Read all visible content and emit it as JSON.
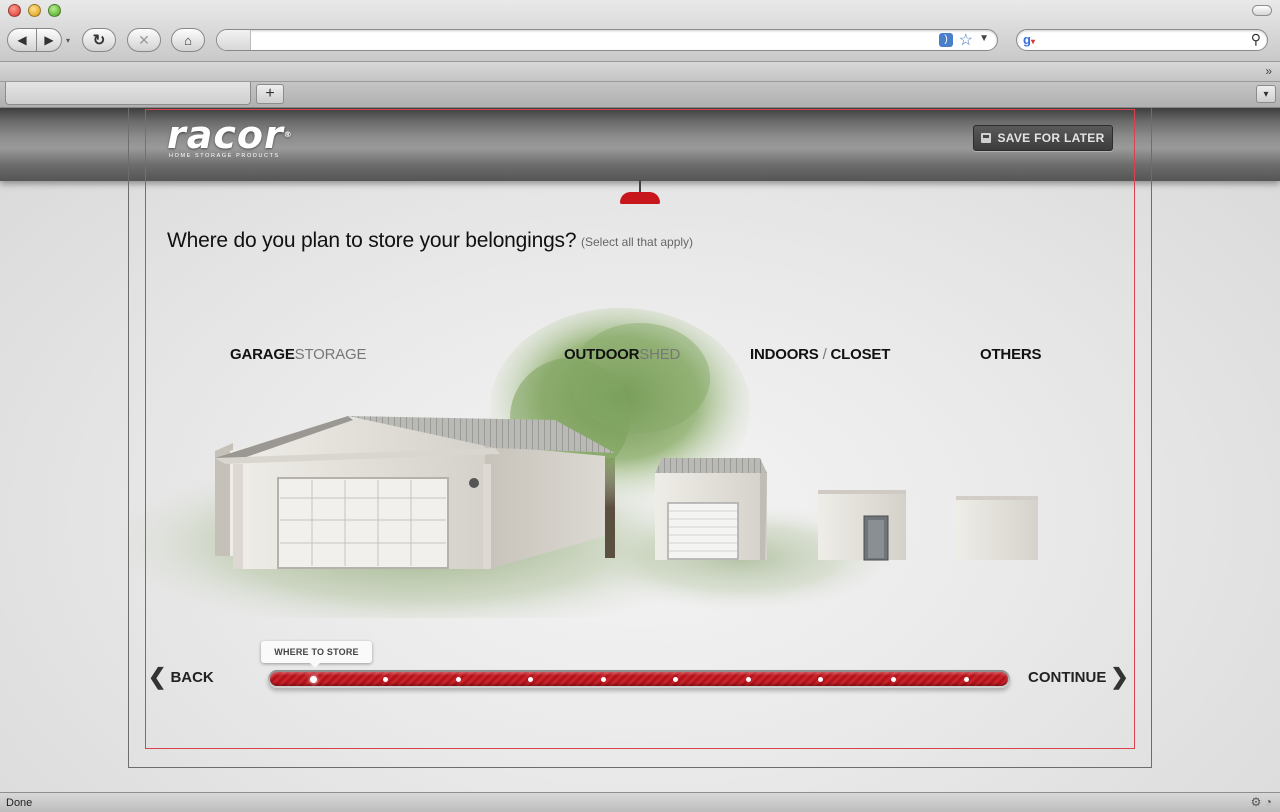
{
  "browser": {
    "url": "",
    "search_value": "",
    "nav_history_arrow": "▾",
    "star": "☆",
    "url_dropdown": "▼",
    "more_chevron": "»",
    "new_tab": "+",
    "tab_list": "▾",
    "status": "Done"
  },
  "header": {
    "logo_word": "racor",
    "logo_reg": "®",
    "logo_tagline": "HOME STORAGE PRODUCTS",
    "save_label": "SAVE FOR LATER"
  },
  "main": {
    "question": "Where do you plan to store your belongings?",
    "hint": "(Select all that apply)",
    "options": [
      {
        "bold": "GARAGE",
        "light": "STORAGE"
      },
      {
        "bold": "OUTDOOR",
        "light": "SHED"
      },
      {
        "bold": "INDOORS",
        "light": " / ",
        "bold2": "CLOSET"
      },
      {
        "bold": "OTHERS",
        "light": ""
      }
    ]
  },
  "footer": {
    "back_label": "BACK",
    "continue_label": "CONTINUE",
    "step_label": "WHERE TO STORE",
    "total_steps": 10,
    "current_step": 1
  },
  "colors": {
    "accent_red": "#c8232a",
    "frame_red": "#d8444d"
  }
}
